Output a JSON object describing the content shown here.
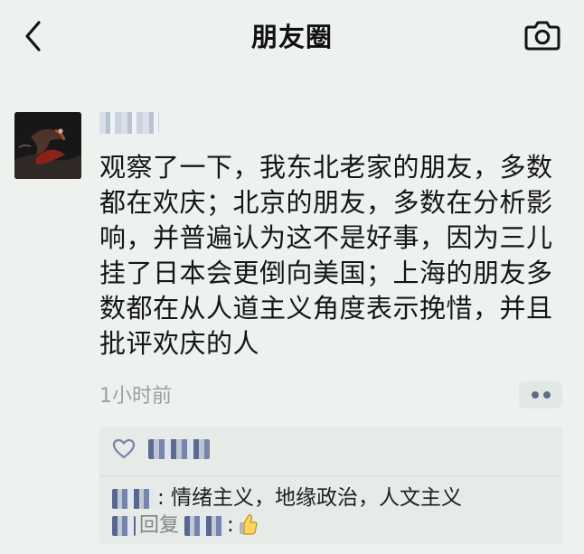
{
  "header": {
    "title": "朋友圈",
    "back_icon": "chevron-left-icon",
    "camera_icon": "camera-icon"
  },
  "post": {
    "author_name": "",
    "avatar_icon": "avatar-image",
    "text": "观察了一下，我东北老家的朋友，多数\n都在欢庆；北京的朋友，多数在分析影\n响，并普遍认为这不是好事，因为三儿\n挂了日本会更倒向美国；上海的朋友多\n数都在从人道主义角度表示挽惜，并且\n批评欢庆的人",
    "timestamp": "1小时前",
    "more_icon": "more-dots-icon"
  },
  "likes": {
    "icon": "heart-icon",
    "names": ""
  },
  "comments": [
    {
      "sep": ":",
      "text": " 情绪主义，地缘政治，人文主义"
    },
    {
      "reply_word": "回复",
      "sep": ":",
      "emoji": "thumbs-up-icon"
    }
  ],
  "colors": {
    "background": "#edf2ee",
    "link_blue": "#576b95",
    "secondary_gray": "#9aa09c"
  }
}
